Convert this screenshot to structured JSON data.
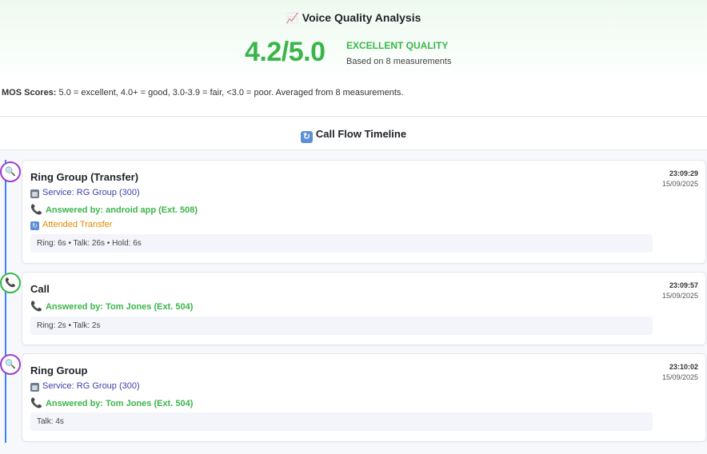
{
  "voice_quality": {
    "icon": "chart-increasing-icon",
    "title": "Voice Quality Analysis",
    "score": "4.2/5.0",
    "rating": "EXCELLENT QUALITY",
    "based_on": "Based on 8 measurements",
    "accent_color": "#3bb54a"
  },
  "mos": {
    "label": "MOS Scores:",
    "text": "5.0 = excellent, 4.0+ = good, 3.0-3.9 = fair, <3.0 = poor. Averaged from 8 measurements."
  },
  "call_flow": {
    "icon": "refresh-icon",
    "title": "Call Flow Timeline",
    "line_color": "#3b82f6",
    "events": [
      {
        "type": "ring-group",
        "marker_icon": "magnifier-icon",
        "title": "Ring Group (Transfer)",
        "time": "23:09:29",
        "date": "15/09/2025",
        "service": "Service: RG Group (300)",
        "answered": "Answered by: android app (Ext. 508)",
        "transfer": "Attended Transfer",
        "stats": "Ring: 6s • Talk: 26s • Hold: 6s"
      },
      {
        "type": "call",
        "marker_icon": "phone-icon",
        "title": "Call",
        "time": "23:09:57",
        "date": "15/09/2025",
        "answered": "Answered by: Tom Jones (Ext. 504)",
        "stats": "Ring: 2s • Talk: 2s"
      },
      {
        "type": "ring-group",
        "marker_icon": "magnifier-icon",
        "title": "Ring Group",
        "time": "23:10:02",
        "date": "15/09/2025",
        "service": "Service: RG Group (300)",
        "answered": "Answered by: Tom Jones (Ext. 504)",
        "stats": "Talk: 4s"
      }
    ]
  }
}
